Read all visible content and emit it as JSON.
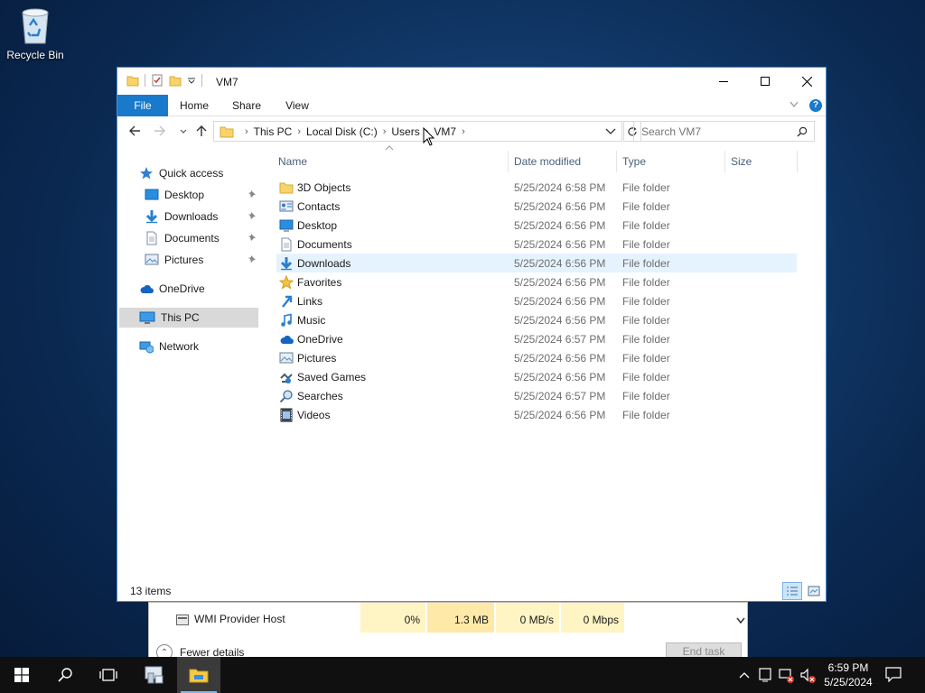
{
  "desktop": {
    "recycle_bin": "Recycle Bin"
  },
  "window": {
    "title": "VM7",
    "ribbon_tabs": [
      "File",
      "Home",
      "Share",
      "View"
    ],
    "address": [
      "This PC",
      "Local Disk (C:)",
      "Users",
      "VM7"
    ],
    "search_placeholder": "Search VM7",
    "accent": "#1979ca"
  },
  "nav_pane": {
    "quick_access": "Quick access",
    "pinned": [
      "Desktop",
      "Downloads",
      "Documents",
      "Pictures"
    ],
    "onedrive": "OneDrive",
    "this_pc": "This PC",
    "network": "Network"
  },
  "columns": {
    "name": "Name",
    "date": "Date modified",
    "type": "Type",
    "size": "Size"
  },
  "files": [
    {
      "name": "3D Objects",
      "date": "5/25/2024 6:58 PM",
      "type": "File folder",
      "icon": "folder-3d-objects-icon"
    },
    {
      "name": "Contacts",
      "date": "5/25/2024 6:56 PM",
      "type": "File folder",
      "icon": "contacts-icon"
    },
    {
      "name": "Desktop",
      "date": "5/25/2024 6:56 PM",
      "type": "File folder",
      "icon": "desktop-icon"
    },
    {
      "name": "Documents",
      "date": "5/25/2024 6:56 PM",
      "type": "File folder",
      "icon": "documents-icon"
    },
    {
      "name": "Downloads",
      "date": "5/25/2024 6:56 PM",
      "type": "File folder",
      "icon": "downloads-icon"
    },
    {
      "name": "Favorites",
      "date": "5/25/2024 6:56 PM",
      "type": "File folder",
      "icon": "favorites-icon"
    },
    {
      "name": "Links",
      "date": "5/25/2024 6:56 PM",
      "type": "File folder",
      "icon": "links-icon"
    },
    {
      "name": "Music",
      "date": "5/25/2024 6:56 PM",
      "type": "File folder",
      "icon": "music-icon"
    },
    {
      "name": "OneDrive",
      "date": "5/25/2024 6:57 PM",
      "type": "File folder",
      "icon": "onedrive-icon"
    },
    {
      "name": "Pictures",
      "date": "5/25/2024 6:56 PM",
      "type": "File folder",
      "icon": "pictures-icon"
    },
    {
      "name": "Saved Games",
      "date": "5/25/2024 6:56 PM",
      "type": "File folder",
      "icon": "saved-games-icon"
    },
    {
      "name": "Searches",
      "date": "5/25/2024 6:57 PM",
      "type": "File folder",
      "icon": "searches-icon"
    },
    {
      "name": "Videos",
      "date": "5/25/2024 6:56 PM",
      "type": "File folder",
      "icon": "videos-icon"
    }
  ],
  "selected_row": "Downloads",
  "status": "13 items",
  "task_manager": {
    "process": "WMI Provider Host",
    "cpu": "0%",
    "memory": "1.3 MB",
    "disk": "0 MB/s",
    "network": "0 Mbps",
    "fewer_details": "Fewer details",
    "end_task": "End task"
  },
  "taskbar": {
    "time": "6:59 PM",
    "date": "5/25/2024"
  }
}
